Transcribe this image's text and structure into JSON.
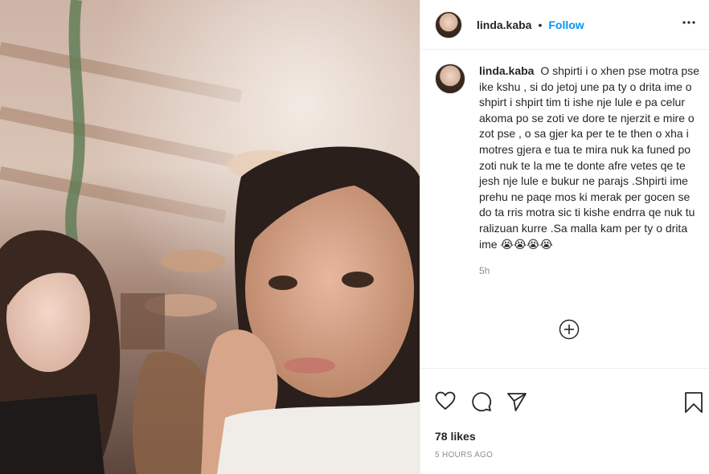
{
  "post": {
    "username": "linda.kaba",
    "separator": "•",
    "follow_label": "Follow",
    "caption_username": "linda.kaba",
    "caption_text": "O shpirti i o xhen pse motra pse ike kshu , si do jetoj une pa ty o drita ime o shpirt i shpirt tim ti ishe nje lule e pa celur akoma po se zoti ve dore te njerzit e mire o zot pse , o sa gjer ka per te te then o xha i motres gjera e tua te mira nuk ka funed po zoti nuk te la me te donte afre vetes qe te jesh nje lule e bukur ne parajs .Shpirti ime prehu ne paqe mos ki merak per gocen se do ta rris motra sic ti kishe endrra qe nuk tu ralizuan kurre .Sa malla kam per ty o drita ime 😭😭😭😭",
    "caption_age": "5h",
    "likes": "78 likes",
    "posted": "5 HOURS AGO"
  },
  "icons": {
    "more": "more-options-icon",
    "load_more": "plus-circle-icon",
    "like": "heart-icon",
    "comment": "comment-icon",
    "share": "paper-plane-icon",
    "save": "bookmark-icon"
  },
  "colors": {
    "accent": "#0095f6",
    "text": "#262626",
    "muted": "#8e8e8e",
    "border": "#efefef"
  }
}
